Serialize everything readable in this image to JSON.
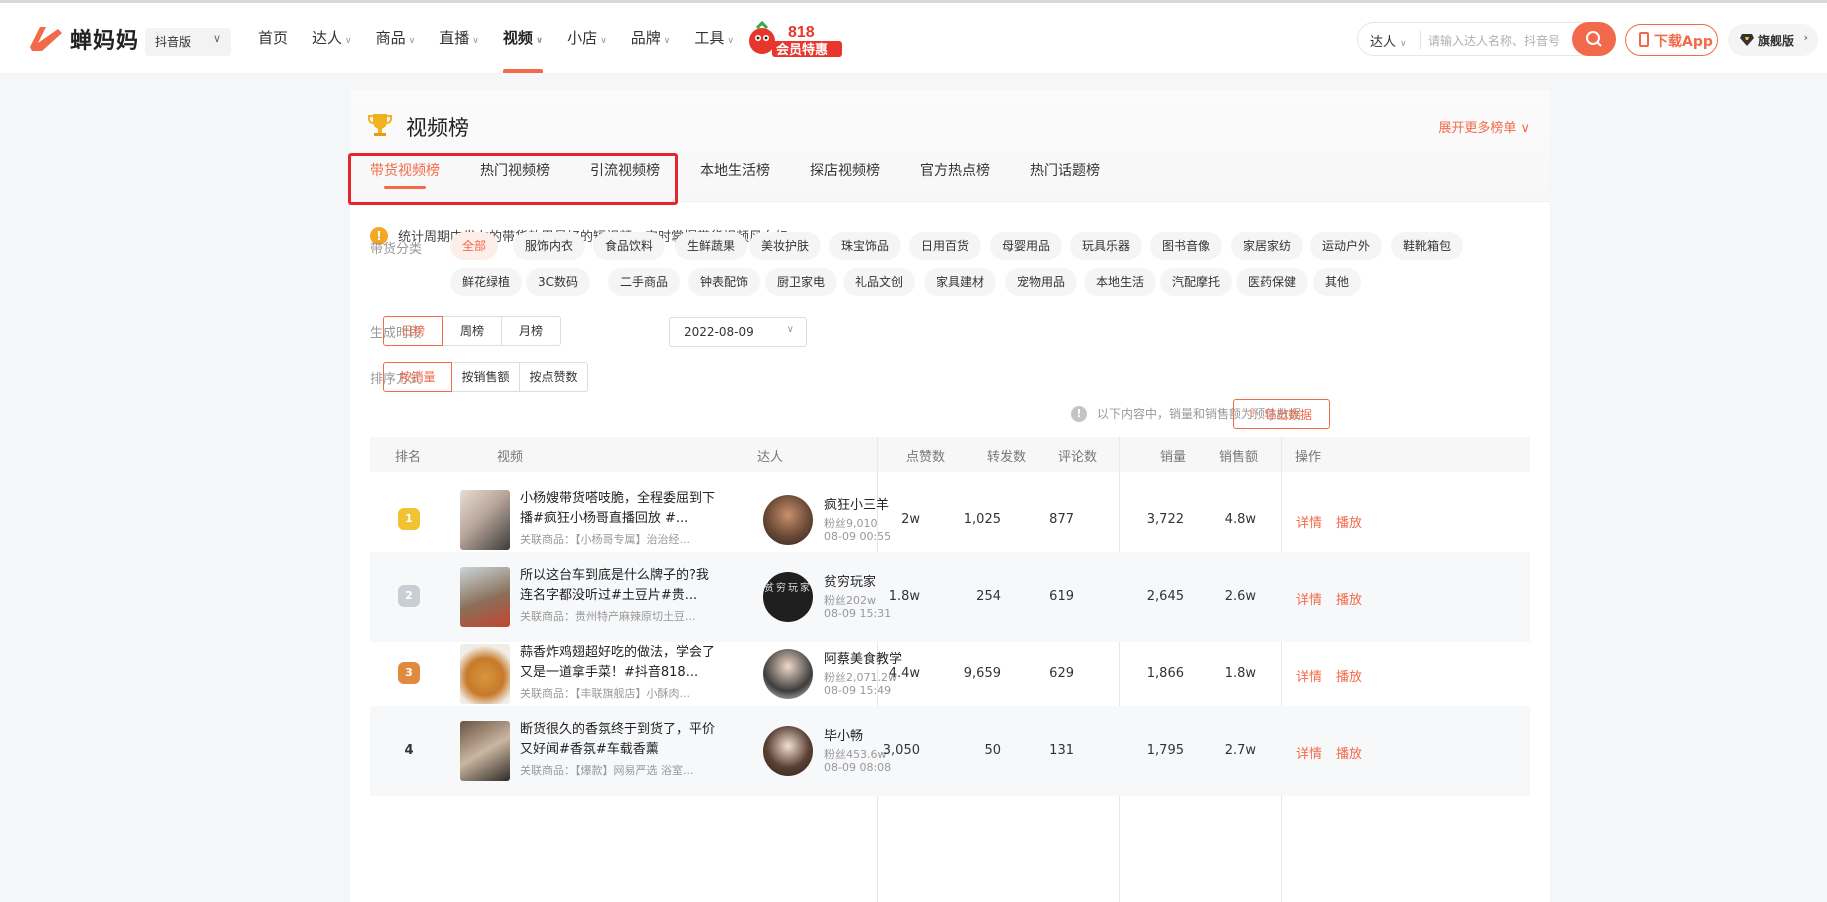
{
  "brand": {
    "name": "蝉妈妈",
    "version": "抖音版",
    "accent": "#f36a4a"
  },
  "nav": [
    {
      "label": "首页",
      "has_menu": false
    },
    {
      "label": "达人",
      "has_menu": true
    },
    {
      "label": "商品",
      "has_menu": true
    },
    {
      "label": "直播",
      "has_menu": true
    },
    {
      "label": "视频",
      "has_menu": true,
      "active": true
    },
    {
      "label": "小店",
      "has_menu": true
    },
    {
      "label": "品牌",
      "has_menu": true
    },
    {
      "label": "工具",
      "has_menu": true
    }
  ],
  "promo": {
    "top": "818",
    "bottom": "会员特惠"
  },
  "search": {
    "scope": "达人",
    "placeholder": "请输入达人名称、抖音号"
  },
  "download_label": "下载App",
  "flagship_label": "旗舰版",
  "panel": {
    "title": "视频榜",
    "expand": "展开更多榜单"
  },
  "tabs": [
    "带货视频榜",
    "热门视频榜",
    "引流视频榜",
    "本地生活榜",
    "探店视频榜",
    "官方热点榜",
    "热门话题榜"
  ],
  "notice": "统计周期内发布的带货效果最好的短视频，实时掌握带货视频风向标。",
  "filters": {
    "category_label": "带货分类",
    "categories": [
      "全部",
      "服饰内衣",
      "食品饮料",
      "生鲜蔬果",
      "美妆护肤",
      "珠宝饰品",
      "日用百货",
      "母婴用品",
      "玩具乐器",
      "图书音像",
      "家居家纺",
      "运动户外",
      "鞋靴箱包",
      "鲜花绿植",
      "3C数码",
      "二手商品",
      "钟表配饰",
      "厨卫家电",
      "礼品文创",
      "家具建材",
      "宠物用品",
      "本地生活",
      "汽配摩托",
      "医药保健",
      "其他"
    ],
    "period_label": "生成时段",
    "periods": [
      "日榜",
      "周榜",
      "月榜"
    ],
    "date": "2022-08-09",
    "sort_label": "排序方式",
    "sorts": [
      "按销量",
      "按销售额",
      "按点赞数"
    ]
  },
  "estimate_note": "以下内容中，销量和销售额为预估数据",
  "export_label": "导出数据",
  "columns": [
    "排名",
    "视频",
    "达人",
    "点赞数",
    "转发数",
    "评论数",
    "销量",
    "销售额",
    "操作"
  ],
  "rows": [
    {
      "rank": "1",
      "title": "小杨嫂带货嗒吱脆，全程委屈到下播#疯狂小杨哥直播回放 #...",
      "product": "关联商品：【小杨哥专属】治治经...",
      "name": "疯狂小三羊",
      "fans": "粉丝9,010",
      "time": "08-09 00:55",
      "likes": "2w",
      "shares": "1,025",
      "comments": "877",
      "sales": "3,722",
      "revenue": "4.8w"
    },
    {
      "rank": "2",
      "title": "所以这台车到底是什么牌子的?我连名字都没听过#土豆片#贵...",
      "product": "关联商品：贵州特产麻辣原切土豆...",
      "name": "贫穷玩家",
      "fans": "粉丝202w",
      "time": "08-09 15:31",
      "likes": "1.8w",
      "shares": "254",
      "comments": "619",
      "sales": "2,645",
      "revenue": "2.6w"
    },
    {
      "rank": "3",
      "title": "蒜香炸鸡翅超好吃的做法，学会了又是一道拿手菜！#抖音818...",
      "product": "关联商品：【丰联旗舰店】小酥肉...",
      "name": "阿蔡美食教学",
      "fans": "粉丝2,071.2w",
      "time": "08-09 15:49",
      "likes": "4.4w",
      "shares": "9,659",
      "comments": "629",
      "sales": "1,866",
      "revenue": "1.8w"
    },
    {
      "rank": "4",
      "title": "断货很久的香氛终于到货了，平价又好闻#香氛#车载香薰",
      "product": "关联商品：【爆款】网易严选 浴室...",
      "name": "毕小畅",
      "fans": "粉丝453.6w",
      "time": "08-09 08:08",
      "likes": "3,050",
      "shares": "50",
      "comments": "131",
      "sales": "1,795",
      "revenue": "2.7w"
    }
  ],
  "actions": {
    "detail": "详情",
    "play": "播放"
  },
  "avatar_text": "贫穷玩家"
}
